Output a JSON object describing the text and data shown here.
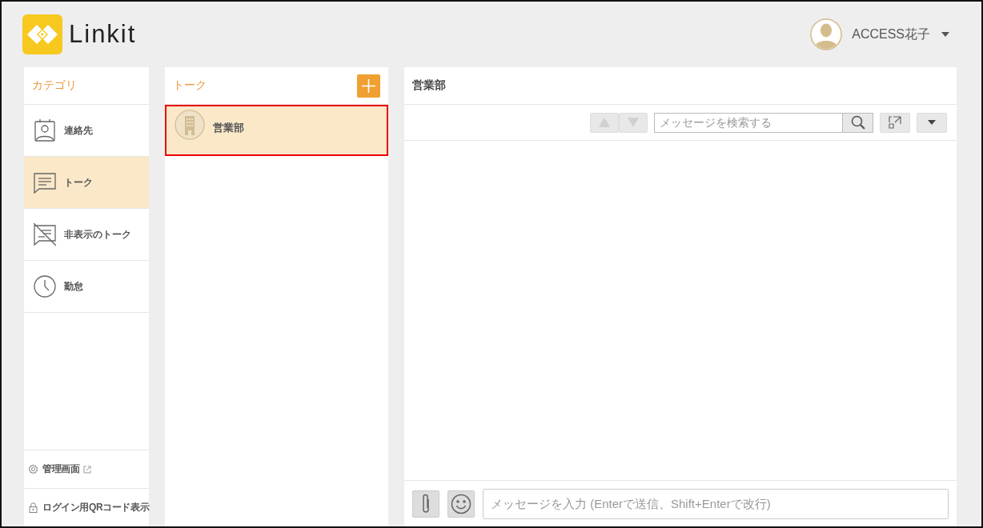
{
  "header": {
    "logo_text": "Linkit",
    "user_name": "ACCESS花子"
  },
  "categories": {
    "title": "カテゴリ",
    "items": [
      {
        "label": "連絡先",
        "kind": "contact",
        "selected": false
      },
      {
        "label": "トーク",
        "kind": "talk",
        "selected": true
      },
      {
        "label": "非表示のトーク",
        "kind": "hidden-talk",
        "selected": false
      },
      {
        "label": "勤怠",
        "kind": "clock",
        "selected": false
      }
    ],
    "footer_items": [
      {
        "label": "管理画面",
        "kind": "gear",
        "external": true
      },
      {
        "label": "ログイン用QRコード表示",
        "kind": "lock"
      }
    ]
  },
  "talks": {
    "title": "トーク",
    "items": [
      {
        "name": "営業部",
        "selected": true
      }
    ]
  },
  "chat": {
    "title": "営業部",
    "search": {
      "placeholder": "メッセージを検索する"
    },
    "composer": {
      "placeholder": "メッセージを入力 (Enterで送信、Shift+Enterで改行)"
    }
  }
}
